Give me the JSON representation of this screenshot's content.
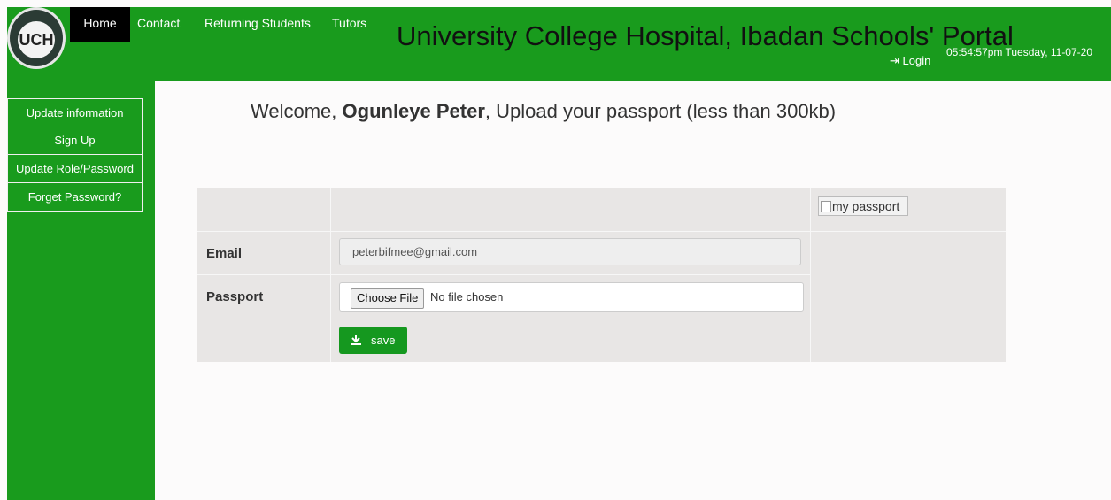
{
  "header": {
    "logo_text": "UCH",
    "nav": {
      "home": "Home",
      "contact": "Contact",
      "returning_students": "Returning Students",
      "tutors": "Tutors"
    },
    "portal_title": "University College Hospital, Ibadan Schools' Portal",
    "login_label": "Login",
    "clock": "05:54:57pm Tuesday, 11-07-20"
  },
  "sidebar": {
    "items": [
      {
        "label": "Update information"
      },
      {
        "label": "Sign Up"
      },
      {
        "label": "Update Role/Password"
      },
      {
        "label": "Forget Password?"
      }
    ]
  },
  "main": {
    "welcome_prefix": "Welcome, ",
    "user_name": "Ogunleye Peter",
    "welcome_suffix": ", Upload your passport (less than 300kb)",
    "passport_alt": "my passport",
    "email_label": "Email",
    "email_value": "peterbifmee@gmail.com",
    "passport_label": "Passport",
    "choose_file": "Choose File",
    "no_file": "No file chosen",
    "save_label": "save"
  },
  "colors": {
    "accent": "#199b1d",
    "nav_active": "#000000"
  }
}
